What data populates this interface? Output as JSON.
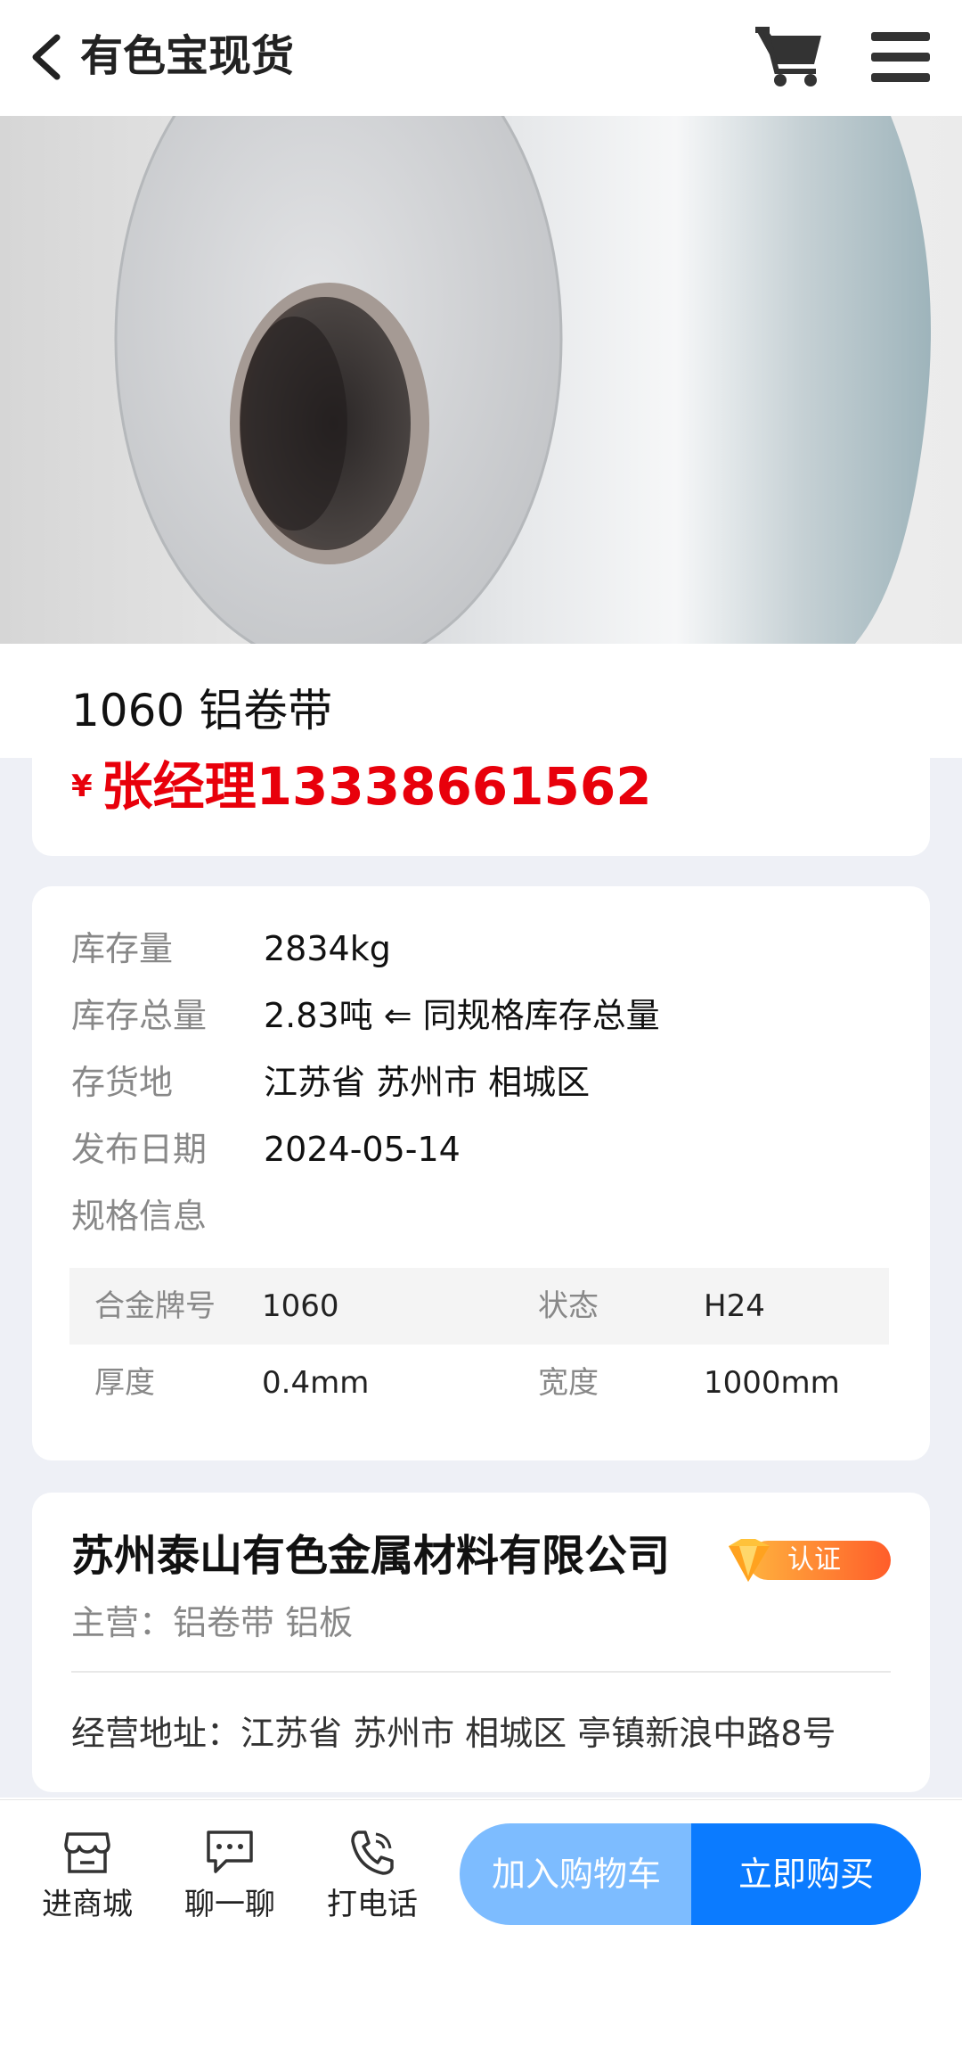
{
  "header": {
    "title": "有色宝现货"
  },
  "product": {
    "name": "1060 铝卷带",
    "currency_symbol": "¥",
    "price_text": "张经理13338661562"
  },
  "details": {
    "rows": [
      {
        "label": "库存量",
        "value": "2834kg"
      },
      {
        "label": "库存总量",
        "value": "2.83吨 ⇐ 同规格库存总量"
      },
      {
        "label": "存货地",
        "value": "江苏省 苏州市 相城区"
      },
      {
        "label": "发布日期",
        "value": "2024-05-14"
      },
      {
        "label": "规格信息",
        "value": ""
      }
    ],
    "spec": [
      {
        "k1": "合金牌号",
        "v1": "1060",
        "k2": "状态",
        "v2": "H24"
      },
      {
        "k1": "厚度",
        "v1": "0.4mm",
        "k2": "宽度",
        "v2": "1000mm"
      }
    ]
  },
  "company": {
    "name": "苏州泰山有色金属材料有限公司",
    "badge": "认证",
    "main_business": "主营：铝卷带  铝板",
    "address": "经营地址：江苏省 苏州市 相城区 亭镇新浪中路8号"
  },
  "bottom_bar": {
    "store": "进商城",
    "chat": "聊一聊",
    "call": "打电话",
    "add_cart": "加入购物车",
    "buy_now": "立即购买"
  },
  "colors": {
    "price_red": "#e8000b",
    "cart_blue": "#7dbcff",
    "buy_blue": "#0b7bff",
    "badge_orange": "#ff7a2e"
  }
}
